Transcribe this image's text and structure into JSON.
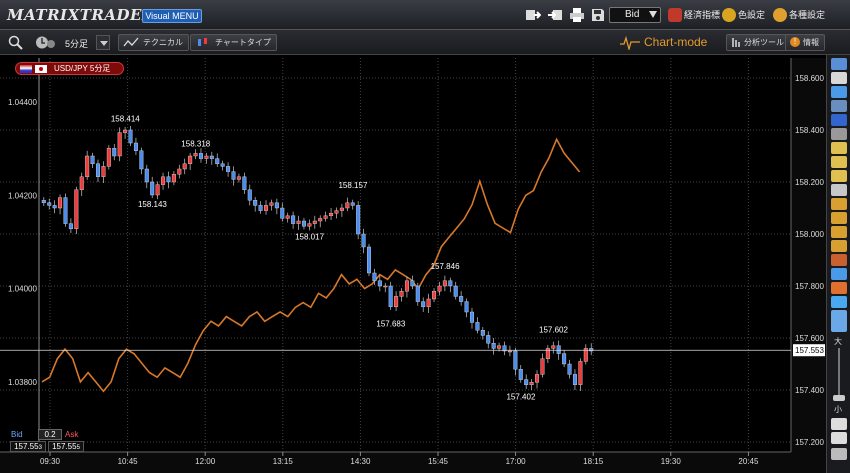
{
  "app": {
    "logo": "MATRIXTRADER",
    "visual_menu": "Visual MENU"
  },
  "topbar": {
    "price_type": "Bid",
    "buttons": [
      {
        "label": "経済指標",
        "icon": "calendar-icon",
        "color": "#c0392b"
      },
      {
        "label": "色設定",
        "icon": "palette-icon",
        "color": "#d9a521"
      },
      {
        "label": "各種設定",
        "icon": "gear-icon",
        "color": "#e0a030"
      }
    ]
  },
  "toolbar": {
    "timeframe": "5分足",
    "technical": "テクニカル",
    "chart_type": "チャートタイプ",
    "chart_mode": "Chart-mode",
    "analysis_tools": "分析ツール",
    "info": "情報"
  },
  "pair": "USD/JPY 5分足",
  "bidask": {
    "bid_label": "Bid",
    "ask_label": "Ask",
    "spread": "0.2",
    "bid": "157.55",
    "bid_small": "3",
    "ask": "157.55",
    "ask_small": "5"
  },
  "chart_data": {
    "type": "candlestick",
    "title": "USD/JPY 5分足",
    "x_ticks": [
      "09:30",
      "10:45",
      "12:00",
      "13:15",
      "14:30",
      "15:45",
      "17:00",
      "18:15",
      "19:30",
      "20:45"
    ],
    "left_axis": {
      "ticks": [
        "1.04400",
        "1.04200",
        "1.04000",
        "1.03800"
      ],
      "values": [
        1.044,
        1.042,
        1.04,
        1.038
      ]
    },
    "right_axis": {
      "ticks": [
        "158.600",
        "158.400",
        "158.200",
        "158.000",
        "157.800",
        "157.600",
        "157.400",
        "157.200"
      ],
      "values": [
        158.6,
        158.4,
        158.2,
        158.0,
        157.8,
        157.6,
        157.4,
        157.2
      ]
    },
    "current_price": "157.553",
    "annotations": [
      {
        "label": "158.414",
        "value": 158.414,
        "idx": 15,
        "pos": "above"
      },
      {
        "label": "158.318",
        "value": 158.318,
        "idx": 28,
        "pos": "above"
      },
      {
        "label": "158.143",
        "value": 158.143,
        "idx": 20,
        "pos": "below"
      },
      {
        "label": "158.157",
        "value": 158.157,
        "idx": 57,
        "pos": "above"
      },
      {
        "label": "158.017",
        "value": 158.017,
        "idx": 49,
        "pos": "below"
      },
      {
        "label": "157.846",
        "value": 157.846,
        "idx": 74,
        "pos": "above"
      },
      {
        "label": "157.683",
        "value": 157.683,
        "idx": 64,
        "pos": "below"
      },
      {
        "label": "157.602",
        "value": 157.602,
        "idx": 94,
        "pos": "above"
      },
      {
        "label": "157.402",
        "value": 157.402,
        "idx": 88,
        "pos": "below"
      }
    ],
    "candles_close": [
      158.12,
      158.11,
      158.1,
      158.14,
      158.04,
      158.02,
      158.17,
      158.22,
      158.3,
      158.27,
      158.22,
      158.26,
      158.33,
      158.3,
      158.39,
      158.4,
      158.35,
      158.32,
      158.25,
      158.2,
      158.15,
      158.19,
      158.22,
      158.2,
      158.23,
      158.25,
      158.27,
      158.3,
      158.31,
      158.29,
      158.3,
      158.29,
      158.27,
      158.26,
      158.24,
      158.21,
      158.22,
      158.17,
      158.13,
      158.11,
      158.09,
      158.11,
      158.12,
      158.1,
      158.06,
      158.07,
      158.04,
      158.05,
      158.03,
      158.04,
      158.05,
      158.06,
      158.07,
      158.08,
      158.09,
      158.1,
      158.12,
      158.11,
      158.0,
      157.95,
      157.85,
      157.82,
      157.8,
      157.8,
      157.72,
      157.76,
      157.78,
      157.82,
      157.8,
      157.74,
      157.72,
      157.75,
      157.78,
      157.8,
      157.82,
      157.8,
      157.76,
      157.74,
      157.7,
      157.66,
      157.63,
      157.61,
      157.58,
      157.56,
      157.57,
      157.55,
      157.55,
      157.48,
      157.44,
      157.42,
      157.43,
      157.46,
      157.52,
      157.56,
      157.57,
      157.54,
      157.5,
      157.46,
      157.42,
      157.51,
      157.56,
      157.55
    ],
    "overlay_line_left": [
      1.038,
      1.0381,
      1.0385,
      1.0387,
      1.0385,
      1.038,
      1.0382,
      1.038,
      1.0378,
      1.038,
      1.0385,
      1.0387,
      1.0386,
      1.0384,
      1.0382,
      1.0381,
      1.0383,
      1.0382,
      1.0381,
      1.0384,
      1.0388,
      1.0391,
      1.0393,
      1.0392,
      1.0394,
      1.0393,
      1.0392,
      1.0394,
      1.0395,
      1.0393,
      1.0394,
      1.0395,
      1.0394,
      1.0396,
      1.0397,
      1.0396,
      1.0399,
      1.0398,
      1.04,
      1.0403,
      1.0401,
      1.0402,
      1.04,
      1.0401,
      1.0403,
      1.0402,
      1.0404,
      1.0403,
      1.0402,
      1.04,
      1.0403,
      1.0405,
      1.0409,
      1.0411,
      1.0413,
      1.0415,
      1.0418,
      1.0423,
      1.0418,
      1.0414,
      1.0413,
      1.0412,
      1.0417,
      1.042,
      1.0421,
      1.0425,
      1.0428,
      1.0432,
      1.0429,
      1.0427,
      1.0425
    ],
    "grid": true
  }
}
